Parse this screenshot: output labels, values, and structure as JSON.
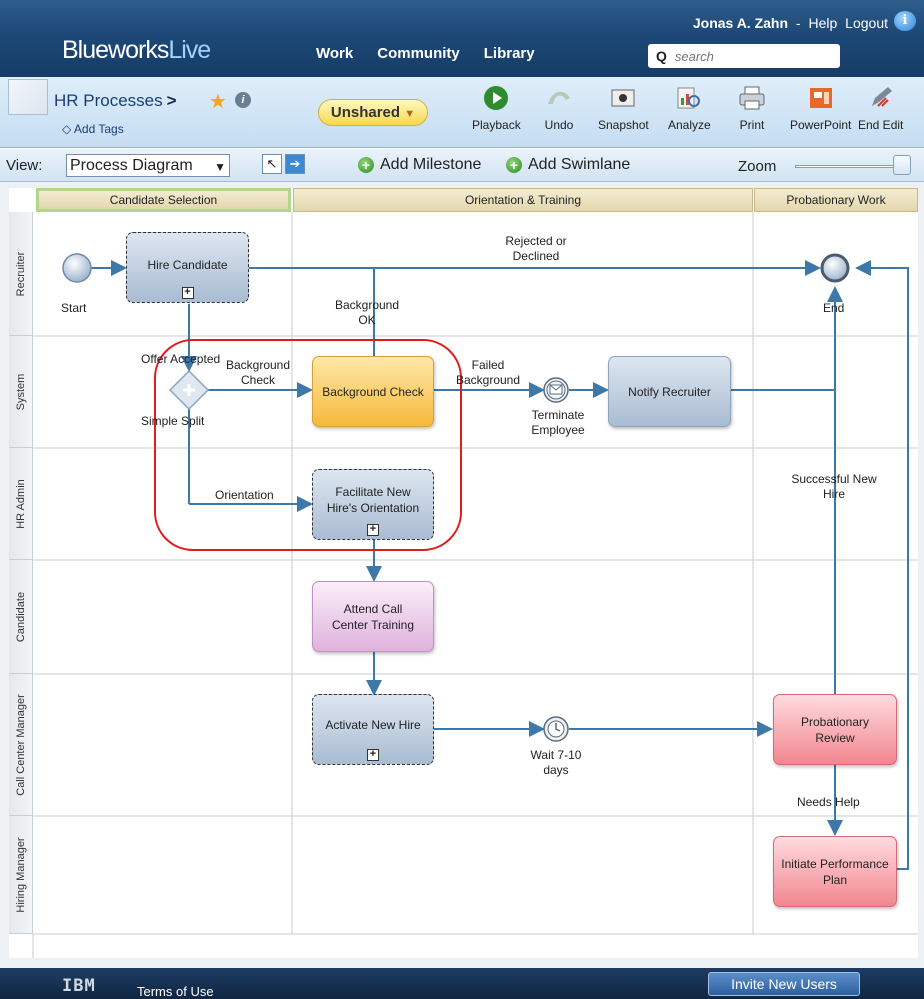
{
  "header": {
    "user_name": "Jonas A. Zahn",
    "help_label": "Help",
    "logout_label": "Logout",
    "logo_main": "Blueworks",
    "logo_accent": "Live",
    "nav": [
      "Work",
      "Community",
      "Library"
    ],
    "search_placeholder": "search"
  },
  "toolbar": {
    "breadcrumb": "HR Processes",
    "breadcrumb_sep": ">",
    "add_tags": "Add Tags",
    "share_status": "Unshared",
    "buttons": [
      "Playback",
      "Undo",
      "Snapshot",
      "Analyze",
      "Print",
      "PowerPoint",
      "End Edit"
    ]
  },
  "viewbar": {
    "view_label": "View:",
    "view_value": "Process Diagram",
    "add_milestone": "Add Milestone",
    "add_swimlane": "Add Swimlane",
    "zoom_label": "Zoom"
  },
  "diagram": {
    "milestones": [
      "Candidate Selection",
      "Orientation & Training",
      "Probationary Work"
    ],
    "lanes": [
      "Recruiter",
      "System",
      "HR Admin",
      "Candidate",
      "Call Center Manager",
      "Hiring Manager"
    ],
    "tasks": {
      "hire_candidate": "Hire Candidate",
      "background_check": "Background Check",
      "notify_recruiter": "Notify Recruiter",
      "facilitate_orientation": "Facilitate New Hire's Orientation",
      "attend_training": "Attend Call Center Training",
      "activate_new_hire": "Activate New Hire",
      "probationary_review": "Probationary Review",
      "initiate_plan": "Initiate Performance Plan"
    },
    "events": {
      "start": "Start",
      "end": "End",
      "terminate": "Terminate Employee",
      "wait": "Wait 7-10 days",
      "split": "Simple Split"
    },
    "flow_labels": {
      "rejected": "Rejected or Declined",
      "background_ok": "Background OK",
      "offer_accepted": "Offer Accepted",
      "background_check": "Background Check",
      "failed_background": "Failed Background",
      "orientation": "Orientation",
      "successful_hire": "Successful New Hire",
      "needs_help": "Needs Help"
    },
    "colors": {
      "connector": "#3d78a8",
      "highlight": "#e01c1c"
    }
  },
  "footer": {
    "ibm": "IBM",
    "terms": "Terms of Use",
    "invite": "Invite New Users"
  }
}
